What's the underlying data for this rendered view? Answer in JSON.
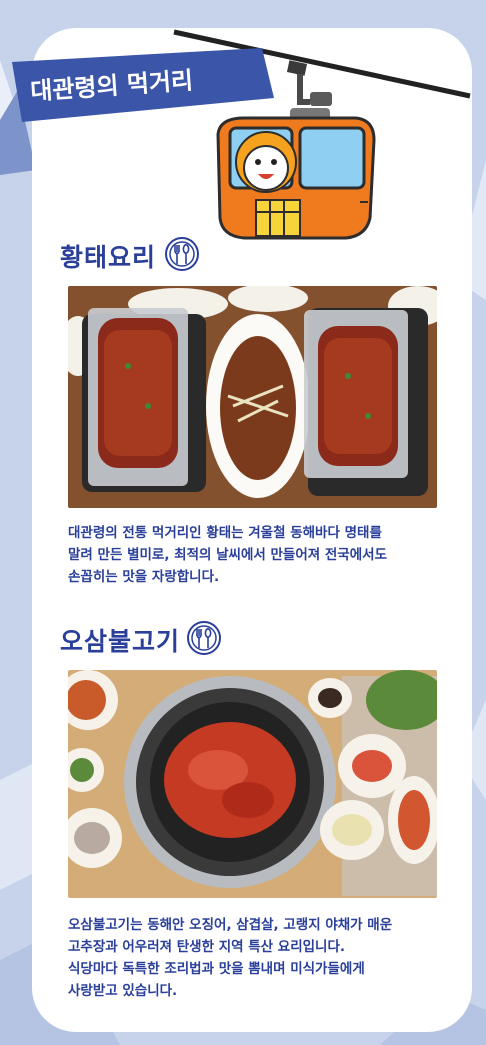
{
  "banner": {
    "title": "대관령의 먹거리"
  },
  "sections": [
    {
      "title": "황태요리",
      "description": "대관령의 전통 먹거리인 황태는 겨울철 동해바다 명태를\n말려 만든 별미로, 최적의 날씨에서 만들어져 전국에서도\n손꼽히는 맛을 자랑합니다."
    },
    {
      "title": "오삼불고기",
      "description": "오삼불고기는 동해안 오징어, 삼겹살, 고랭지 야채가 매운\n고추장과 어우러져 탄생한 지역 특산 요리입니다.\n식당마다 독특한 조리법과 맛을 뽐내며 미식가들에게\n사랑받고 있습니다."
    }
  ],
  "icons": {
    "section_icon": "fork-and-spoon-icon"
  },
  "colors": {
    "title": "#2a3f99",
    "banner": "#3b55a8",
    "cable_car": "#f07a1e"
  }
}
